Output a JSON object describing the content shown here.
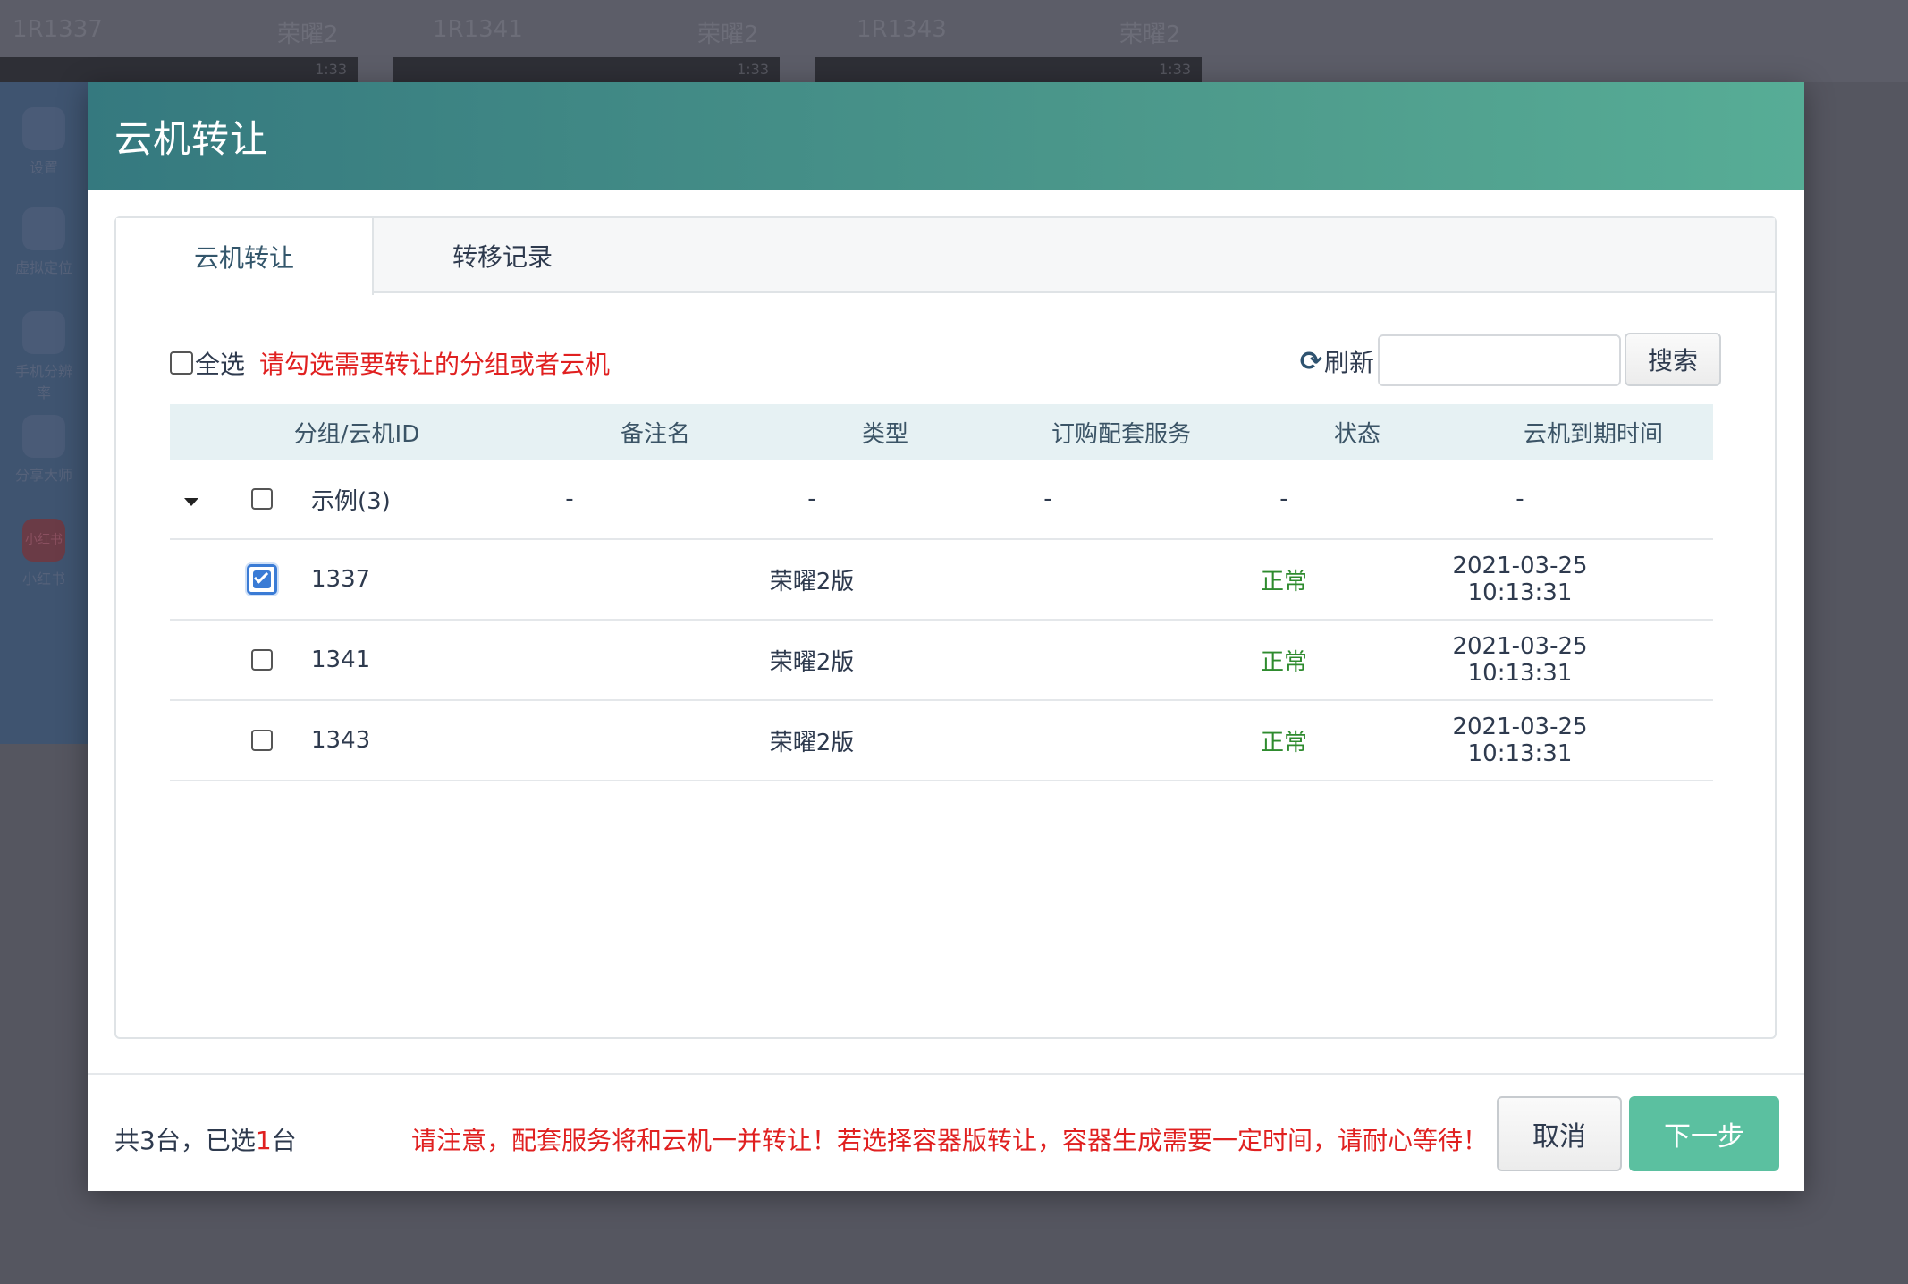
{
  "background": {
    "phones": [
      {
        "name": "1R1337",
        "brand": "荣曜2",
        "time": "1:33"
      },
      {
        "name": "1R1341",
        "brand": "荣曜2",
        "time": "1:33"
      },
      {
        "name": "1R1343",
        "brand": "荣曜2",
        "time": "1:33"
      }
    ],
    "apps": [
      "设置",
      "虚拟定位",
      "手机分辨率",
      "分享大师",
      "小红书"
    ],
    "app_icon_text": "小红书"
  },
  "modal": {
    "title": "云机转让",
    "tabs": [
      {
        "label": "云机转让",
        "active": true
      },
      {
        "label": "转移记录",
        "active": false
      }
    ],
    "toolbar": {
      "select_all_label": "全选",
      "hint": "请勾选需要转让的分组或者云机",
      "refresh_label": "刷新",
      "search_value": "",
      "search_button": "搜索"
    },
    "table": {
      "columns": [
        "分组/云机ID",
        "备注名",
        "类型",
        "订购配套服务",
        "状态",
        "云机到期时间"
      ],
      "group": {
        "name": "示例(3)",
        "note": "-",
        "type": "-",
        "service": "-",
        "status": "-",
        "expire": "-"
      },
      "rows": [
        {
          "id": "1337",
          "note": "",
          "type": "荣曜2版",
          "service": "",
          "status": "正常",
          "expire": "2021-03-25 10:13:31",
          "checked": true
        },
        {
          "id": "1341",
          "note": "",
          "type": "荣曜2版",
          "service": "",
          "status": "正常",
          "expire": "2021-03-25 10:13:31",
          "checked": false
        },
        {
          "id": "1343",
          "note": "",
          "type": "荣曜2版",
          "service": "",
          "status": "正常",
          "expire": "2021-03-25 10:13:31",
          "checked": false
        }
      ]
    },
    "footer": {
      "count_prefix": "共3台，已选",
      "selected": "1",
      "count_suffix": "台",
      "notice": "请注意，配套服务将和云机一并转让！若选择容器版转让，容器生成需要一定时间，请耐心等待！",
      "cancel_label": "取消",
      "next_label": "下一步"
    },
    "colors": {
      "header_start": "#35797f",
      "header_end": "#57ad96",
      "accent_next": "#5bc0a0",
      "warning_red": "#e02020",
      "status_ok": "#2e8b2e"
    }
  }
}
